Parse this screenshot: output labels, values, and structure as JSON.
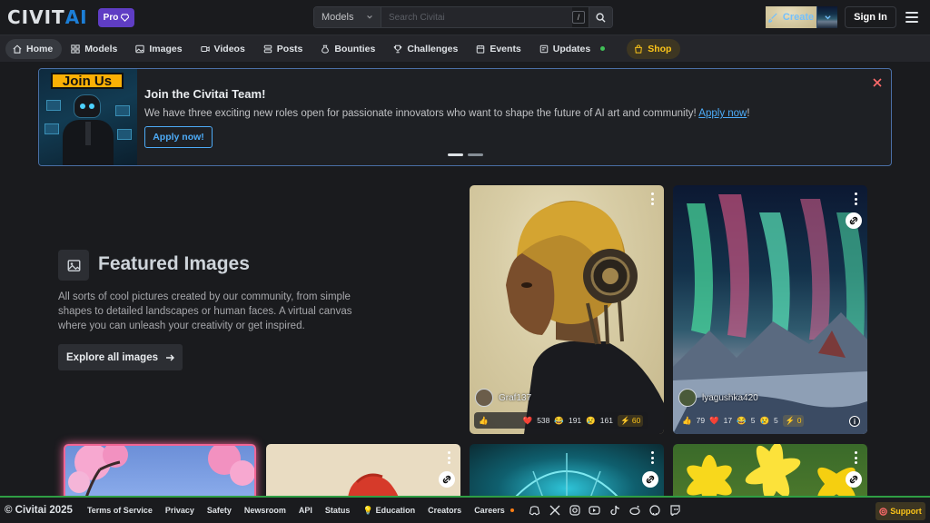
{
  "header": {
    "logo_part1": "CIVIT",
    "logo_part2": "AI",
    "pro_label": "Pro",
    "search": {
      "scope": "Models",
      "placeholder": "Search Civitai",
      "shortcut": "/"
    },
    "create_label": "Create",
    "signin_label": "Sign In"
  },
  "nav": {
    "items": [
      {
        "label": "Home",
        "icon": "home-icon",
        "active": true
      },
      {
        "label": "Models",
        "icon": "models-icon"
      },
      {
        "label": "Images",
        "icon": "image-icon"
      },
      {
        "label": "Videos",
        "icon": "video-icon"
      },
      {
        "label": "Posts",
        "icon": "posts-icon"
      },
      {
        "label": "Bounties",
        "icon": "bounty-icon"
      },
      {
        "label": "Challenges",
        "icon": "trophy-icon"
      },
      {
        "label": "Events",
        "icon": "calendar-icon"
      },
      {
        "label": "Updates",
        "icon": "updates-icon"
      },
      {
        "label": "Shop",
        "icon": "shop-icon"
      }
    ]
  },
  "banner": {
    "art_label": "Join Us",
    "title": "Join the Civitai Team!",
    "text": "We have three exciting new roles open for passionate innovators who want to shape the future of AI art and community!",
    "text_link": "Apply now",
    "text_end": "!",
    "button": "Apply now!"
  },
  "featured": {
    "title": "Featured Images",
    "description": "All sorts of cool pictures created by our community, from simple shapes to detailed landscapes or human faces. A virtual canvas where you can unleash your creativity or get inspired.",
    "button": "Explore all images"
  },
  "cards": [
    {
      "user": "Graf137",
      "likes": "",
      "hearts": "538",
      "laughs": "191",
      "cries": "161",
      "buzz": "60"
    },
    {
      "user": "lyagushka420",
      "likes": "79",
      "hearts": "17",
      "laughs": "5",
      "cries": "5",
      "buzz": "0"
    }
  ],
  "footer": {
    "copyright": "© Civitai 2025",
    "links": [
      "Terms of Service",
      "Privacy",
      "Safety",
      "Newsroom",
      "API",
      "Status",
      "Education",
      "Creators",
      "Careers"
    ],
    "support": "Support"
  },
  "colors": {
    "accent": "#1c7ed6",
    "pro": "#5f3dc4",
    "shop": "#fcc419",
    "footer_border": "#2f9e44"
  }
}
